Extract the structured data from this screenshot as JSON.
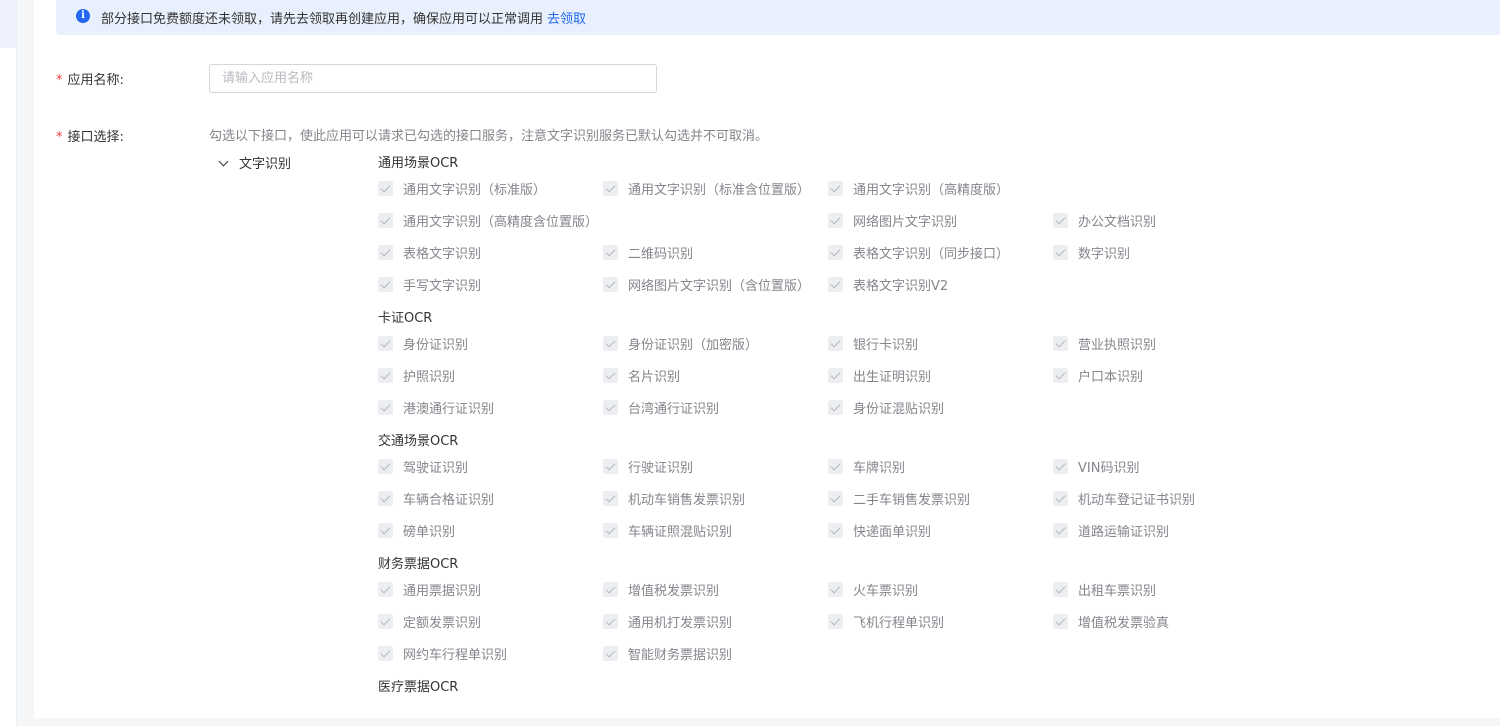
{
  "notice": {
    "text": "部分接口免费额度还未领取，请先去领取再创建应用，确保应用可以正常调用",
    "link": "去领取"
  },
  "form": {
    "name_label": "应用名称:",
    "name_placeholder": "请输入应用名称",
    "name_value": "",
    "api_label": "接口选择:",
    "hint": "勾选以下接口，使此应用可以请求已勾选的接口服务，注意文字识别服务已默认勾选并不可取消。",
    "required_mark": "*"
  },
  "tree": {
    "category": "文字识别",
    "expanded": true
  },
  "groups": [
    {
      "title": "通用场景OCR",
      "rows": [
        [
          {
            "label": "通用文字识别（标准版）",
            "checked": true
          },
          {
            "label": "通用文字识别（标准含位置版）",
            "checked": true
          },
          {
            "label": "通用文字识别（高精度版）",
            "checked": true
          }
        ],
        [
          {
            "label": "通用文字识别（高精度含位置版）",
            "checked": true,
            "wide": true
          },
          {
            "label": "网络图片文字识别",
            "checked": true
          },
          {
            "label": "办公文档识别",
            "checked": true
          }
        ],
        [
          {
            "label": "表格文字识别",
            "checked": true
          },
          {
            "label": "二维码识别",
            "checked": true
          },
          {
            "label": "表格文字识别（同步接口）",
            "checked": true
          },
          {
            "label": "数字识别",
            "checked": true
          }
        ],
        [
          {
            "label": "手写文字识别",
            "checked": true
          },
          {
            "label": "网络图片文字识别（含位置版）",
            "checked": true
          },
          {
            "label": "表格文字识别V2",
            "checked": true
          }
        ]
      ]
    },
    {
      "title": "卡证OCR",
      "rows": [
        [
          {
            "label": "身份证识别",
            "checked": true
          },
          {
            "label": "身份证识别（加密版）",
            "checked": true
          },
          {
            "label": "银行卡识别",
            "checked": true
          },
          {
            "label": "营业执照识别",
            "checked": true
          }
        ],
        [
          {
            "label": "护照识别",
            "checked": true
          },
          {
            "label": "名片识别",
            "checked": true
          },
          {
            "label": "出生证明识别",
            "checked": true
          },
          {
            "label": "户口本识别",
            "checked": true
          }
        ],
        [
          {
            "label": "港澳通行证识别",
            "checked": true
          },
          {
            "label": "台湾通行证识别",
            "checked": true
          },
          {
            "label": "身份证混贴识别",
            "checked": true
          }
        ]
      ]
    },
    {
      "title": "交通场景OCR",
      "rows": [
        [
          {
            "label": "驾驶证识别",
            "checked": true
          },
          {
            "label": "行驶证识别",
            "checked": true
          },
          {
            "label": "车牌识别",
            "checked": true
          },
          {
            "label": "VIN码识别",
            "checked": true
          }
        ],
        [
          {
            "label": "车辆合格证识别",
            "checked": true
          },
          {
            "label": "机动车销售发票识别",
            "checked": true
          },
          {
            "label": "二手车销售发票识别",
            "checked": true
          },
          {
            "label": "机动车登记证书识别",
            "checked": true
          }
        ],
        [
          {
            "label": "磅单识别",
            "checked": true
          },
          {
            "label": "车辆证照混贴识别",
            "checked": true
          },
          {
            "label": "快递面单识别",
            "checked": true
          },
          {
            "label": "道路运输证识别",
            "checked": true
          }
        ]
      ]
    },
    {
      "title": "财务票据OCR",
      "rows": [
        [
          {
            "label": "通用票据识别",
            "checked": true
          },
          {
            "label": "增值税发票识别",
            "checked": true
          },
          {
            "label": "火车票识别",
            "checked": true
          },
          {
            "label": "出租车票识别",
            "checked": true
          }
        ],
        [
          {
            "label": "定额发票识别",
            "checked": true
          },
          {
            "label": "通用机打发票识别",
            "checked": true
          },
          {
            "label": "飞机行程单识别",
            "checked": true
          },
          {
            "label": "增值税发票验真",
            "checked": true
          }
        ],
        [
          {
            "label": "网约车行程单识别",
            "checked": true
          },
          {
            "label": "智能财务票据识别",
            "checked": true
          }
        ]
      ]
    },
    {
      "title": "医疗票据OCR",
      "rows": []
    }
  ],
  "colors": {
    "primary": "#2468f2",
    "required": "#f33e3e",
    "notice_bg": "#e9f0fd",
    "disabled_text": "#84868c",
    "disabled_checkbox": "#eceef1"
  }
}
